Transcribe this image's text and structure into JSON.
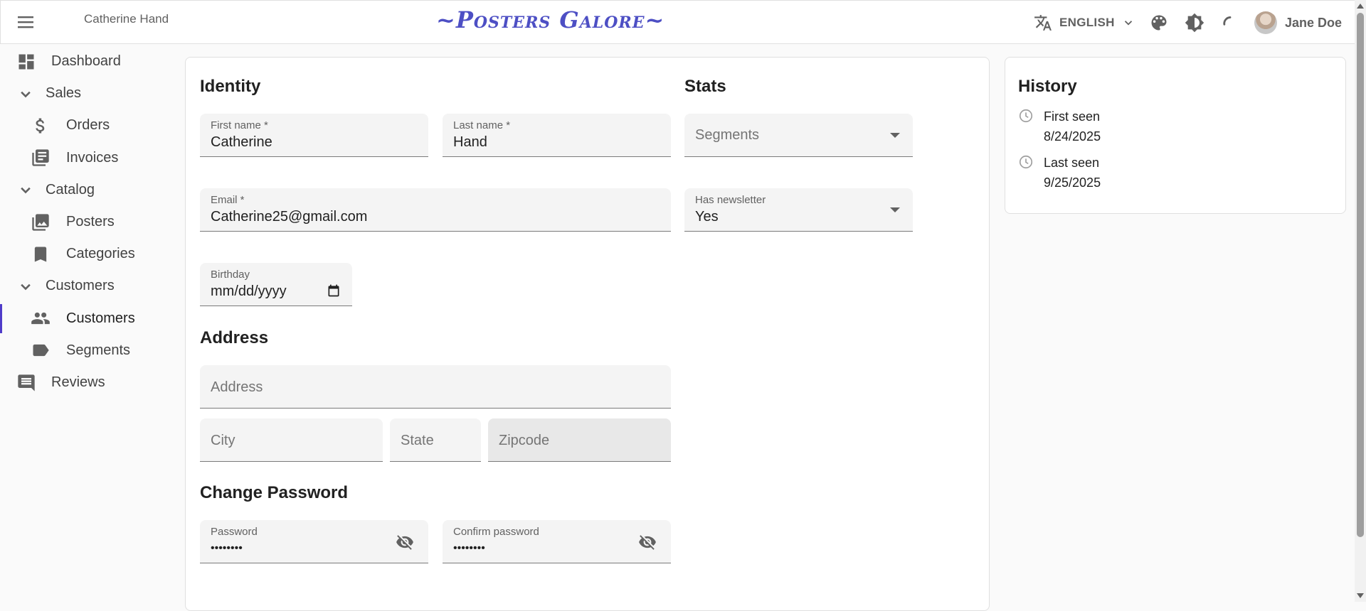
{
  "appbar": {
    "title": "Catherine Hand",
    "logo": "~Posters Galore~",
    "language": "ENGLISH",
    "user_name": "Jane Doe"
  },
  "sidebar": {
    "items": [
      {
        "label": "Dashboard",
        "icon": "dashboard-icon"
      },
      {
        "label": "Sales",
        "icon": "chevron-down-icon"
      },
      {
        "label": "Orders",
        "icon": "dollar-icon"
      },
      {
        "label": "Invoices",
        "icon": "invoices-icon"
      },
      {
        "label": "Catalog",
        "icon": "chevron-down-icon"
      },
      {
        "label": "Posters",
        "icon": "image-icon"
      },
      {
        "label": "Categories",
        "icon": "bookmark-icon"
      },
      {
        "label": "Customers",
        "icon": "chevron-down-icon"
      },
      {
        "label": "Customers",
        "icon": "people-icon"
      },
      {
        "label": "Segments",
        "icon": "label-icon"
      },
      {
        "label": "Reviews",
        "icon": "comment-icon"
      }
    ]
  },
  "identity": {
    "heading": "Identity",
    "first_name_label": "First name *",
    "first_name": "Catherine",
    "last_name_label": "Last name *",
    "last_name": "Hand",
    "email_label": "Email *",
    "email": "Catherine25@gmail.com",
    "birthday_label": "Birthday",
    "birthday_placeholder": "mm/dd/yyyy"
  },
  "stats": {
    "heading": "Stats",
    "segments_placeholder": "Segments",
    "newsletter_label": "Has newsletter",
    "newsletter_value": "Yes"
  },
  "address": {
    "heading": "Address",
    "address_placeholder": "Address",
    "city_placeholder": "City",
    "state_placeholder": "State",
    "zipcode_placeholder": "Zipcode"
  },
  "password": {
    "heading": "Change Password",
    "password_label": "Password",
    "password_value": "••••••••",
    "confirm_label": "Confirm password",
    "confirm_value": "••••••••"
  },
  "history": {
    "heading": "History",
    "first_seen_label": "First seen",
    "first_seen": "8/24/2025",
    "last_seen_label": "Last seen",
    "last_seen": "9/25/2025"
  },
  "colors": {
    "accent": "#4f3cc9",
    "logo": "#4d4fc4"
  }
}
